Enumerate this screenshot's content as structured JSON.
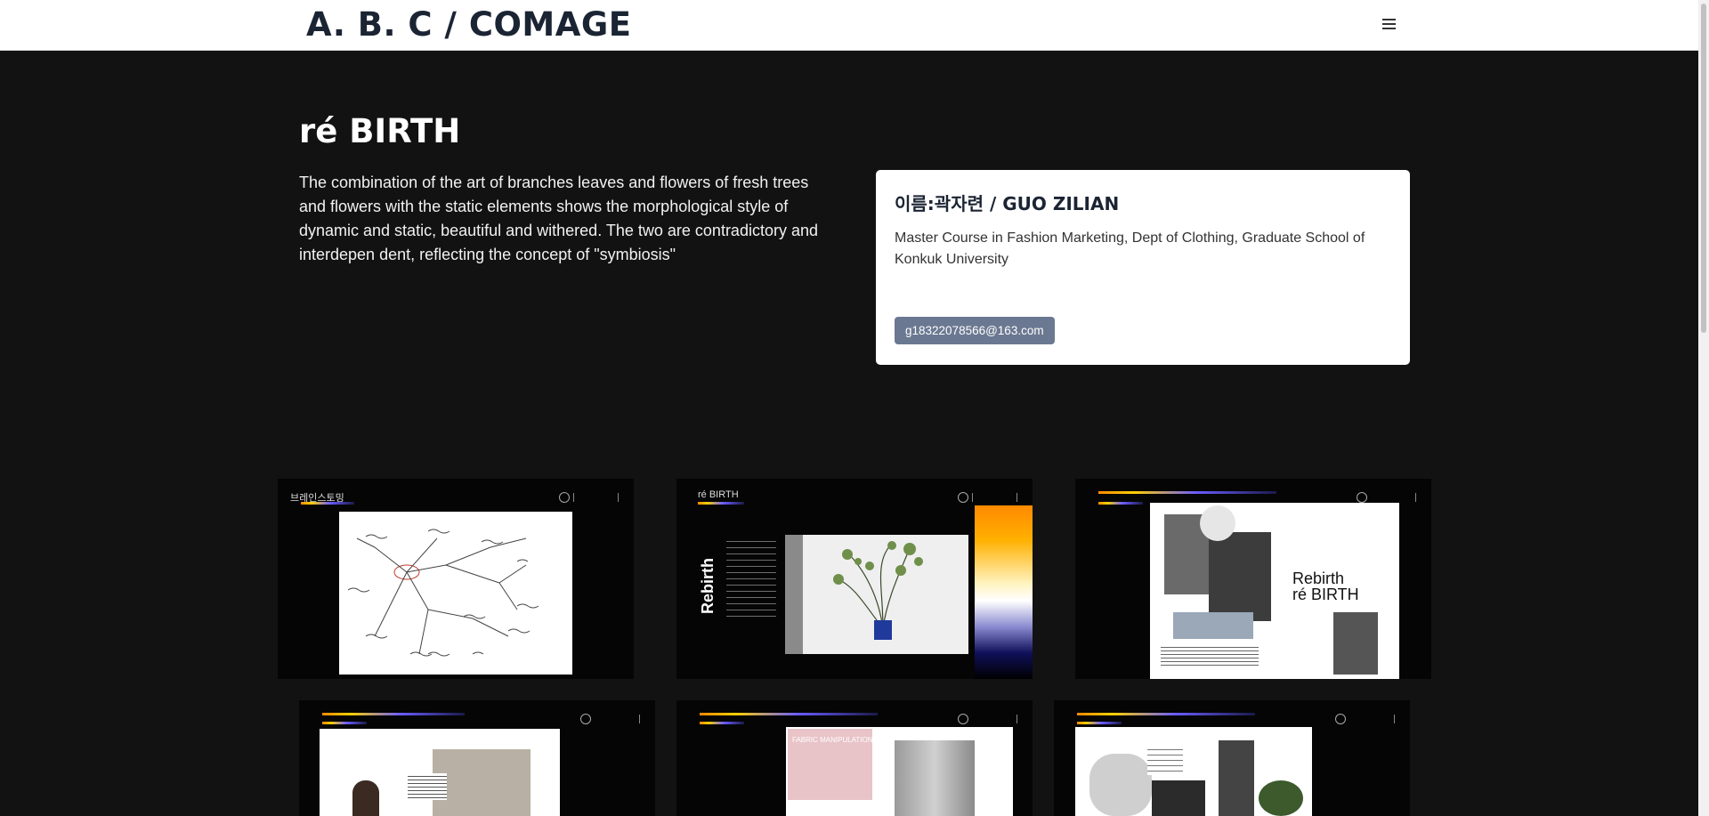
{
  "header": {
    "brand": "A. B. C / COMAGE",
    "menu_icon": "hamburger-menu-icon"
  },
  "hero": {
    "title": "ré BIRTH",
    "description": "The combination of the art of branches leaves and flowers of fresh trees and flowers with the static elements shows the morphological style of dynamic and static, beautiful and withered. The two are contradictory and interdepen dent, reflecting the concept of \"symbiosis\""
  },
  "profile_card": {
    "name": "이름:곽자련 / GUO ZILIAN",
    "affiliation": "Master Course in Fashion Marketing, Dept of Clothing, Graduate School of Konkuk University",
    "email": "g18322078566@163.com"
  },
  "gallery": {
    "thumb1": {
      "label": "브레인스토밍"
    },
    "thumb2": {
      "label": "ré BIRTH",
      "side_title": "Rebirth"
    },
    "thumb3": {
      "title_a": "Rebirth",
      "title_b": "ré BIRTH"
    },
    "thumb5": {
      "label": "FABRIC MANIPULATION"
    }
  },
  "colors": {
    "background": "#121212",
    "header_bg": "#ffffff",
    "brand_text": "#1b2433",
    "email_button": "#6b7891"
  }
}
